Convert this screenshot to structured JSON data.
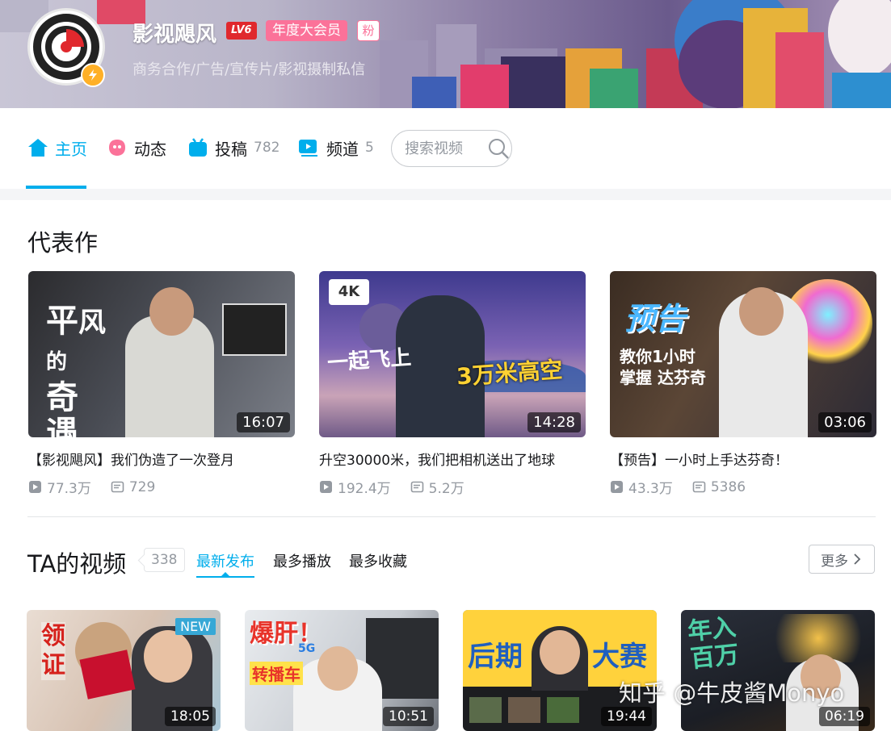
{
  "header": {
    "username": "影视飓风",
    "level": "LV6",
    "vip_label": "年度大会员",
    "fan_badge": "粉",
    "sign": "商务合作/广告/宣传片/影视摄制私信"
  },
  "nav": {
    "items": [
      {
        "label": "主页",
        "count": ""
      },
      {
        "label": "动态",
        "count": ""
      },
      {
        "label": "投稿",
        "count": "782"
      },
      {
        "label": "频道",
        "count": "5"
      }
    ],
    "search_placeholder": "搜索视频"
  },
  "representative": {
    "title": "代表作",
    "videos": [
      {
        "title": "【影视飓风】我们伪造了一次登月",
        "duration": "16:07",
        "plays": "77.3万",
        "danmaku": "729",
        "thumb_text": [
          "平",
          "的",
          "风",
          "奇",
          "遇"
        ]
      },
      {
        "title": "升空30000米，我们把相机送出了地球",
        "duration": "14:28",
        "plays": "192.4万",
        "danmaku": "5.2万",
        "thumb_text": [
          "4K",
          "一起飞上",
          "3万米高空"
        ]
      },
      {
        "title": "【预告】一小时上手达芬奇！",
        "duration": "03:06",
        "plays": "43.3万",
        "danmaku": "5386",
        "thumb_text": [
          "预告",
          "教你1小时",
          "掌握 达芬奇"
        ]
      }
    ]
  },
  "ta_videos": {
    "title": "TA的视频",
    "count": "338",
    "tabs": [
      "最新发布",
      "最多播放",
      "最多收藏"
    ],
    "more_label": "更多",
    "videos": [
      {
        "duration": "18:05",
        "badge": "NEW",
        "thumb_text": [
          "领",
          "证"
        ]
      },
      {
        "duration": "10:51",
        "badge": "",
        "thumb_text": [
          "爆肝！",
          "5G",
          "转播车"
        ]
      },
      {
        "duration": "19:44",
        "badge": "",
        "thumb_text": [
          "后期",
          "大赛"
        ]
      },
      {
        "duration": "06:19",
        "badge": "",
        "thumb_text": [
          "年入",
          "百万"
        ]
      }
    ]
  },
  "watermark": "知乎 @牛皮酱Monyo",
  "colors": {
    "accent": "#00aeec",
    "vip_pink": "#fb7299",
    "level_red": "#e0282d"
  }
}
